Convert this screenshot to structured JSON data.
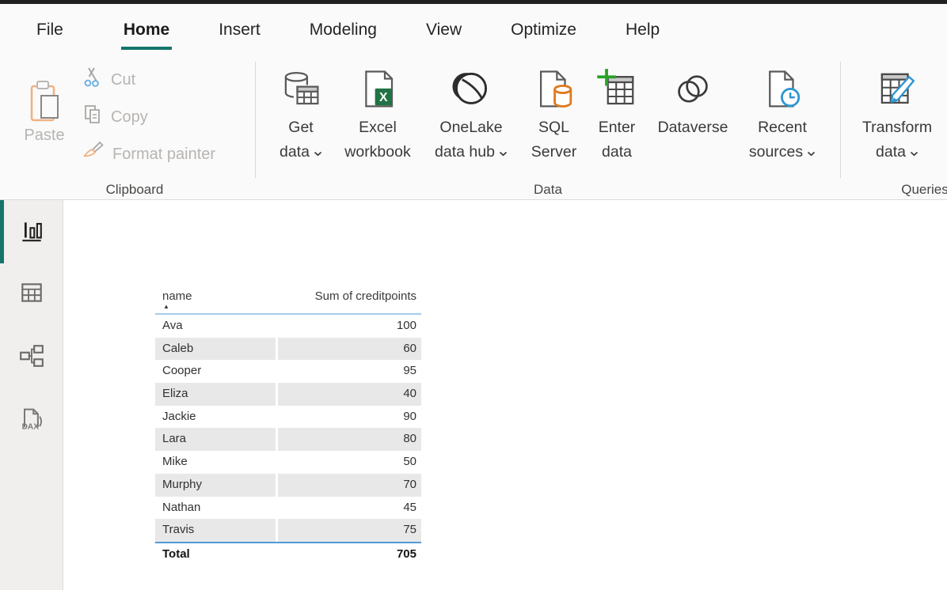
{
  "menu": {
    "items": [
      {
        "label": "File",
        "active": false
      },
      {
        "label": "Home",
        "active": true
      },
      {
        "label": "Insert",
        "active": false
      },
      {
        "label": "Modeling",
        "active": false
      },
      {
        "label": "View",
        "active": false
      },
      {
        "label": "Optimize",
        "active": false
      },
      {
        "label": "Help",
        "active": false
      }
    ]
  },
  "ribbon": {
    "groups": {
      "clipboard": {
        "label": "Clipboard",
        "paste": "Paste",
        "cut": "Cut",
        "copy": "Copy",
        "format_painter": "Format painter"
      },
      "data": {
        "label": "Data",
        "get_data": {
          "line1": "Get",
          "line2": "data",
          "dropdown": true
        },
        "excel_workbook": {
          "line1": "Excel",
          "line2": "workbook",
          "icon_letter": "X",
          "dropdown": false
        },
        "onelake": {
          "line1": "OneLake",
          "line2": "data hub",
          "dropdown": true
        },
        "sql_server": {
          "line1": "SQL",
          "line2": "Server",
          "dropdown": false
        },
        "enter_data": {
          "line1": "Enter",
          "line2": "data",
          "dropdown": false
        },
        "dataverse": {
          "line1": "Dataverse",
          "dropdown": false
        },
        "recent_sources": {
          "line1": "Recent",
          "line2": "sources",
          "dropdown": true
        }
      },
      "queries": {
        "label": "Queries",
        "transform_data": {
          "line1": "Transform",
          "line2": "data",
          "dropdown": true
        }
      }
    }
  },
  "sidebar": {
    "items": [
      {
        "name": "report-view",
        "active": true
      },
      {
        "name": "data-view",
        "active": false
      },
      {
        "name": "model-view",
        "active": false
      },
      {
        "name": "dax-query-view",
        "active": false,
        "icon_text": "DAX"
      }
    ]
  },
  "canvas": {
    "table": {
      "columns": [
        {
          "header": "name",
          "sorted": "asc"
        },
        {
          "header": "Sum of creditpoints"
        }
      ],
      "rows": [
        {
          "name": "Ava",
          "value": "100"
        },
        {
          "name": "Caleb",
          "value": "60"
        },
        {
          "name": "Cooper",
          "value": "95"
        },
        {
          "name": "Eliza",
          "value": "40"
        },
        {
          "name": "Jackie",
          "value": "90"
        },
        {
          "name": "Lara",
          "value": "80"
        },
        {
          "name": "Mike",
          "value": "50"
        },
        {
          "name": "Murphy",
          "value": "70"
        },
        {
          "name": "Nathan",
          "value": "45"
        },
        {
          "name": "Travis",
          "value": "75"
        }
      ],
      "total": {
        "name": "Total",
        "value": "705"
      }
    }
  },
  "colors": {
    "accent_teal": "#15756b",
    "excel_green": "#217346",
    "sql_orange": "#e0791b",
    "enter_plus_green": "#28a228",
    "clock_blue": "#2e95d3",
    "pencil_blue": "#2e95d3",
    "paste_clipboard_tan": "#efb285",
    "table_header_line_blue": "#a5cbec",
    "table_total_line_blue": "#4f9bd8",
    "row_band_gray": "#e8e8e8"
  }
}
